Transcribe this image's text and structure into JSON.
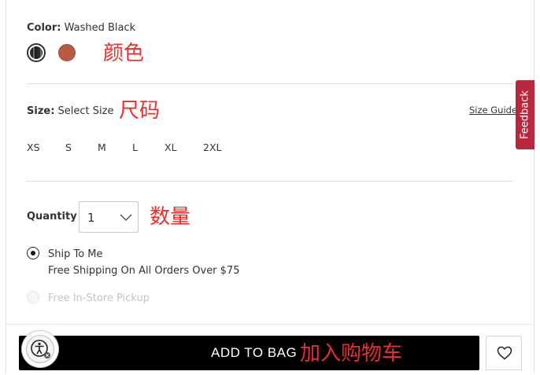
{
  "color": {
    "label": "Color:",
    "value": "Washed Black",
    "annotation": "颜色",
    "swatches": [
      {
        "name": "Washed Black",
        "hex": "#2a2a2a",
        "selected": true
      },
      {
        "name": "rust",
        "hex": "#b85a40",
        "selected": false
      }
    ]
  },
  "size": {
    "label": "Size:",
    "value": "Select Size",
    "annotation": "尺码",
    "guide_link": "Size Guide",
    "options": [
      "XS",
      "S",
      "M",
      "L",
      "XL",
      "2XL"
    ]
  },
  "feedback": {
    "label": "Feedback",
    "color": "#b8283c"
  },
  "quantity": {
    "label": "Quantity",
    "value": "1",
    "annotation": "数量"
  },
  "shipping": {
    "ship_to_me": "Ship To Me",
    "ship_note": "Free Shipping On All Orders Over $75",
    "pickup": "Free In-Store Pickup"
  },
  "actions": {
    "add_to_bag": "ADD TO BAG",
    "add_annotation": "加入购物车",
    "wishlist_icon": "heart-icon",
    "accessibility_icon": "accessibility-icon"
  },
  "colors": {
    "annotation": "#e8302e",
    "button_bg": "#000000"
  }
}
